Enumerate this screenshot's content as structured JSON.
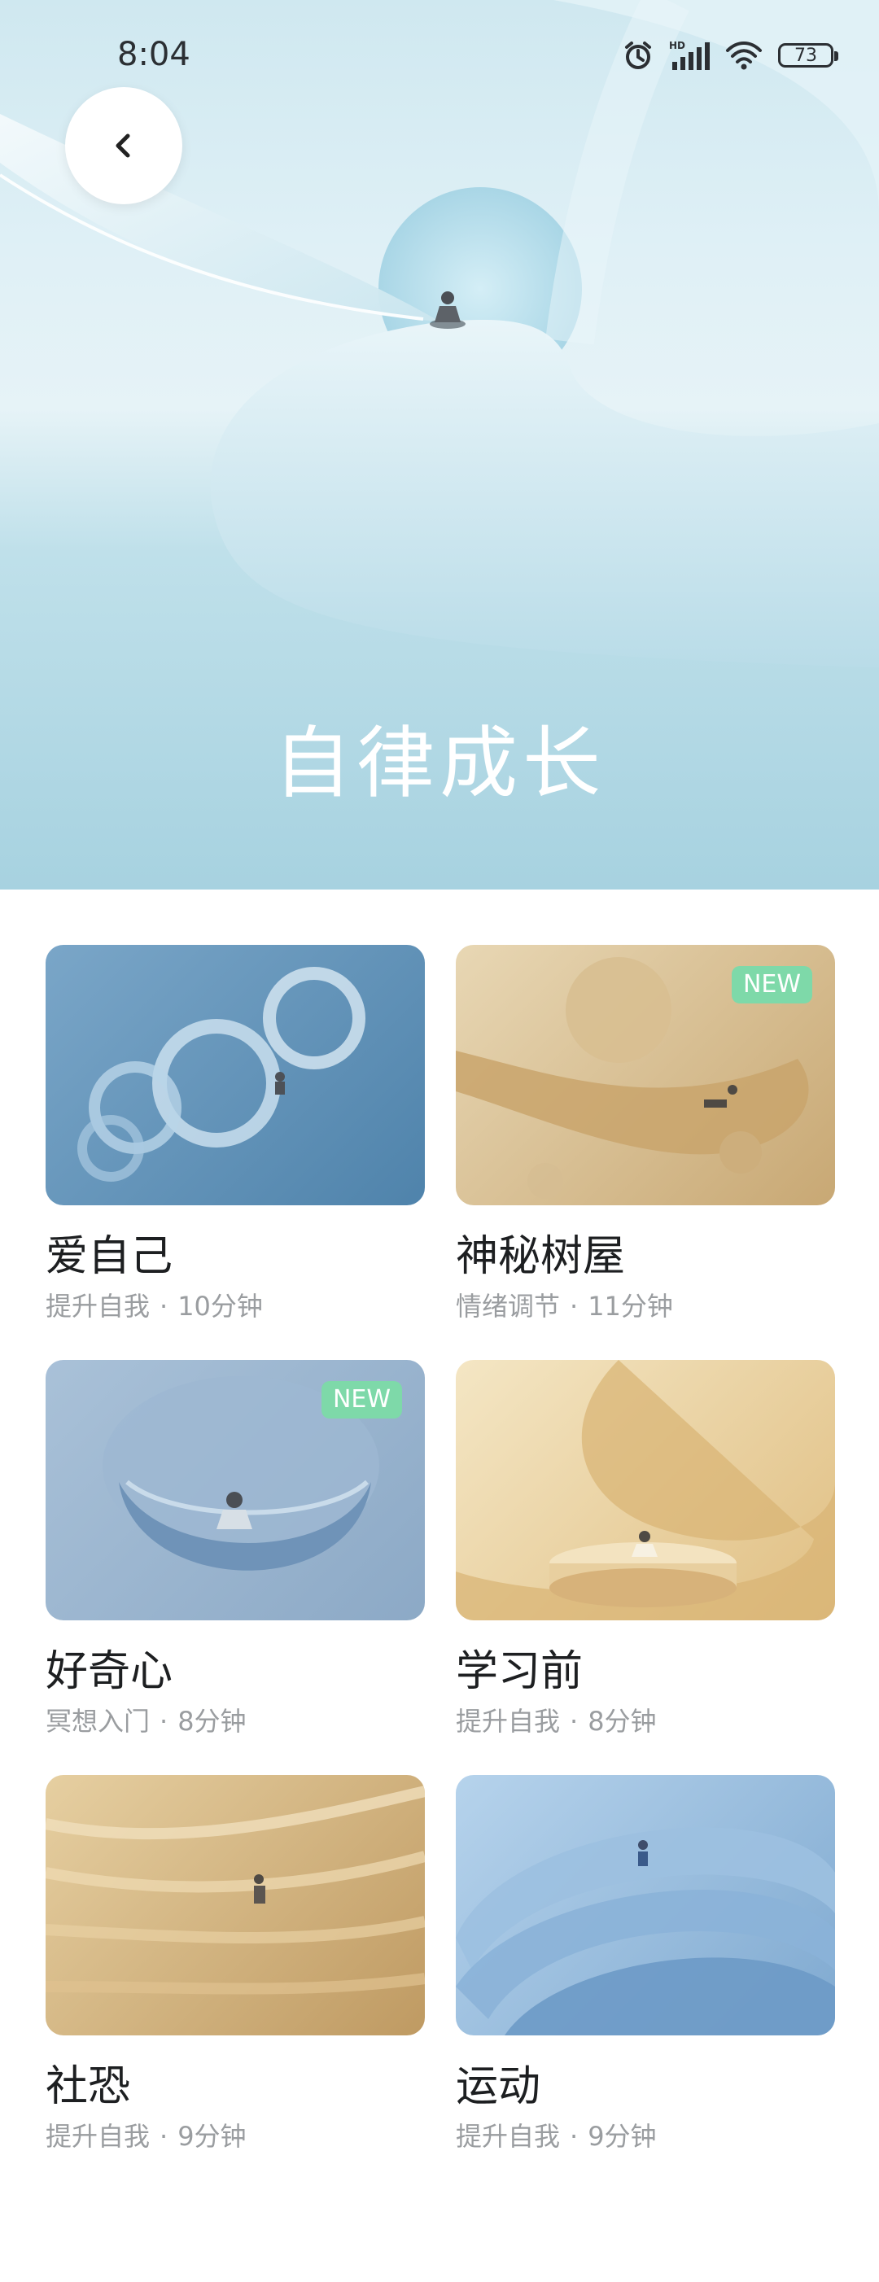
{
  "status_bar": {
    "time": "8:04",
    "battery": "73",
    "icons": [
      "alarm-icon",
      "hd-signal-icon",
      "wifi-icon",
      "battery-icon"
    ]
  },
  "header": {
    "back_icon": "chevron-left-icon",
    "title": "自律成长"
  },
  "colors": {
    "badge": "#7ed9a9",
    "title_text": "#1d1f21",
    "meta_text": "#9a9da0"
  },
  "cards": [
    {
      "title": "爱自己",
      "category": "提升自我",
      "separator": "·",
      "duration": "10分钟",
      "badge": "",
      "theme": "blue-spirals"
    },
    {
      "title": "神秘树屋",
      "category": "情绪调节",
      "separator": "·",
      "duration": "11分钟",
      "badge": "NEW",
      "theme": "sand-spheres"
    },
    {
      "title": "好奇心",
      "category": "冥想入门",
      "separator": "·",
      "duration": "8分钟",
      "badge": "NEW",
      "theme": "blue-bowl"
    },
    {
      "title": "学习前",
      "category": "提升自我",
      "separator": "·",
      "duration": "8分钟",
      "badge": "",
      "theme": "sand-spiral"
    },
    {
      "title": "社恐",
      "category": "提升自我",
      "separator": "·",
      "duration": "9分钟",
      "badge": "",
      "theme": "sand-waves"
    },
    {
      "title": "运动",
      "category": "提升自我",
      "separator": "·",
      "duration": "9分钟",
      "badge": "",
      "theme": "blue-arches"
    }
  ]
}
